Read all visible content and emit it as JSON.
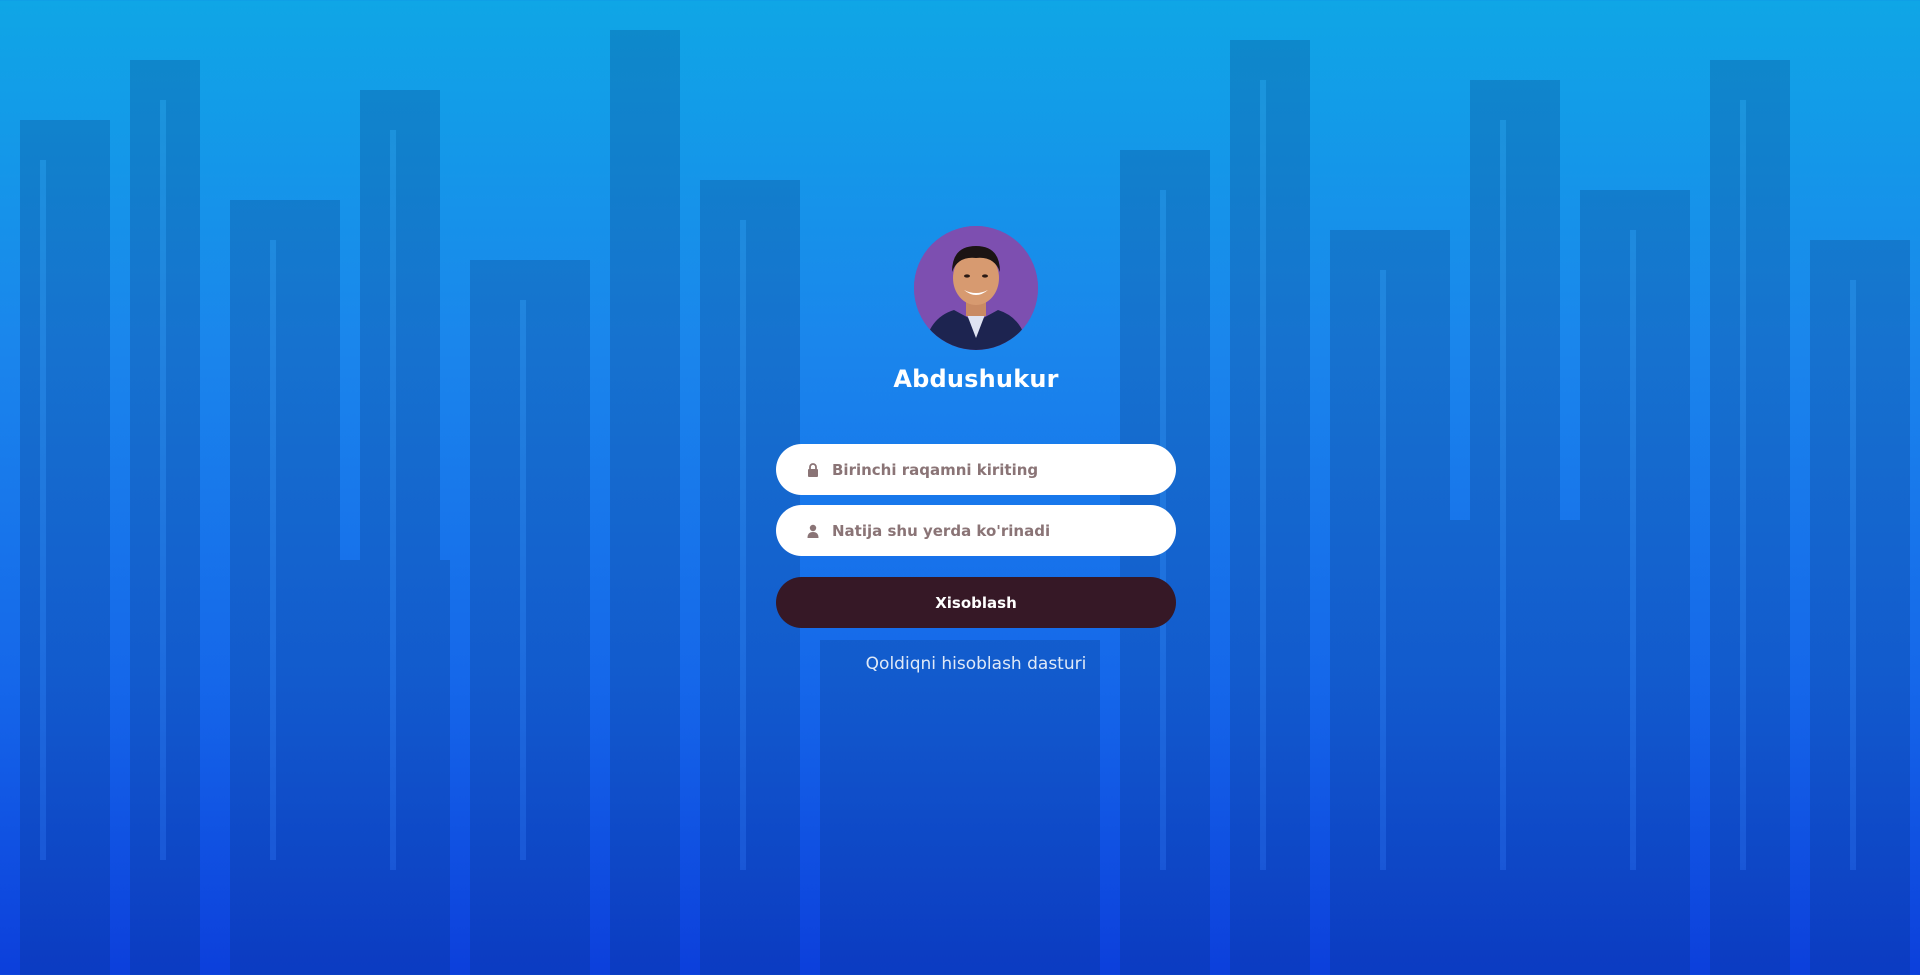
{
  "profile": {
    "name": "Abdushukur"
  },
  "form": {
    "first_input": {
      "placeholder": "Birinchi raqamni kiriting",
      "value": "",
      "icon": "lock-icon"
    },
    "result_input": {
      "placeholder": "Natija shu yerda ko'rinadi",
      "value": "",
      "icon": "user-icon"
    },
    "submit_label": "Xisoblash"
  },
  "footer": {
    "text": "Qoldiqni hisoblash dasturi"
  },
  "colors": {
    "background_top": "#0fa6e6",
    "background_bottom": "#0c3fdb",
    "button": "#361826",
    "input_text": "#8a7476",
    "avatar_bg": "#7d4fb0"
  }
}
